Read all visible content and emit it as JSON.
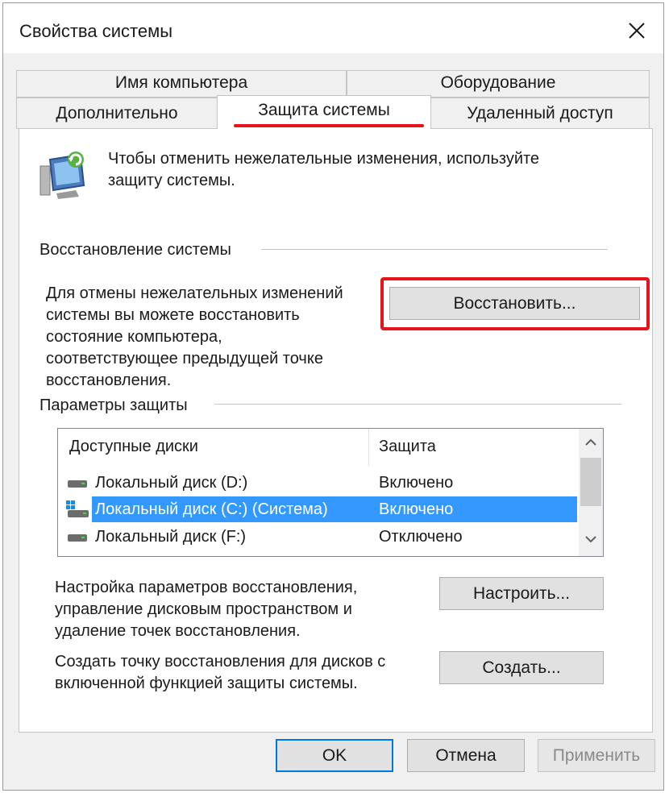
{
  "window": {
    "title": "Свойства системы"
  },
  "tabs": {
    "computer_name": "Имя компьютера",
    "hardware": "Оборудование",
    "advanced": "Дополнительно",
    "system_protection": "Защита системы",
    "remote": "Удаленный доступ"
  },
  "intro": {
    "text_line1": "Чтобы отменить нежелательные изменения, используйте",
    "text_line2": "защиту системы.",
    "icon": "system-protection-icon"
  },
  "restore": {
    "heading": "Восстановление системы",
    "desc_lines": [
      "Для отмены нежелательных изменений",
      "системы вы можете восстановить",
      "состояние компьютера,",
      "соответствующее предыдущей точке",
      "восстановления."
    ],
    "button": "Восстановить..."
  },
  "protection": {
    "heading": "Параметры защиты",
    "columns": [
      "Доступные диски",
      "Защита"
    ],
    "rows": [
      {
        "name": "Локальный диск (D:)",
        "status": "Включено",
        "selected": false,
        "icon": "drive-icon"
      },
      {
        "name": "Локальный диск (C:) (Система)",
        "status": "Включено",
        "selected": true,
        "icon": "system-drive-icon"
      },
      {
        "name": "Локальный диск (F:)",
        "status": "Отключено",
        "selected": false,
        "icon": "drive-icon"
      }
    ]
  },
  "configure": {
    "desc_lines": [
      "Настройка параметров восстановления,",
      "управление дисковым пространством и",
      "удаление точек восстановления."
    ],
    "button": "Настроить..."
  },
  "create": {
    "desc_lines": [
      "Создать точку восстановления для дисков с",
      "включенной функцией защиты системы."
    ],
    "button": "Создать..."
  },
  "footer": {
    "ok": "OK",
    "cancel": "Отмена",
    "apply": "Применить"
  },
  "colors": {
    "highlight_red": "#e8141b",
    "selection_blue": "#3399ff",
    "dialog_bg": "#f0f0f0"
  }
}
